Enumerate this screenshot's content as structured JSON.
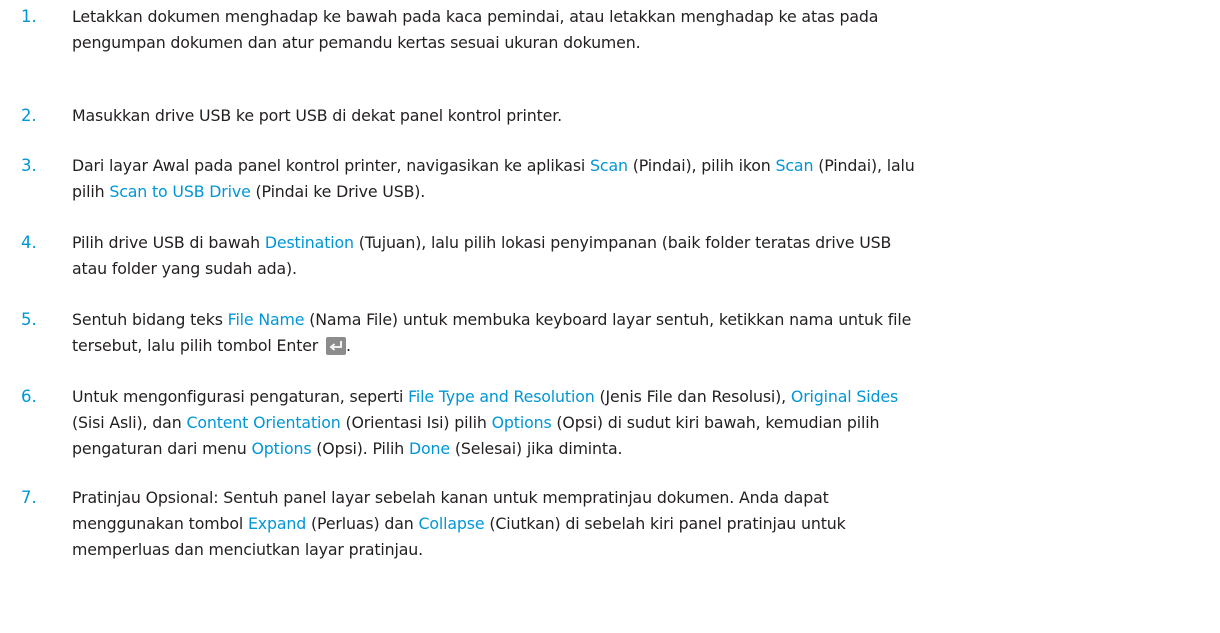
{
  "steps": [
    {
      "number": "1.",
      "lines": [
        [
          {
            "t": "Letakkan dokumen menghadap ke bawah pada kaca pemindai, atau letakkan menghadap ke atas pada"
          }
        ],
        [
          {
            "t": "pengumpan dokumen dan atur pemandu kertas sesuai ukuran dokumen."
          }
        ]
      ]
    },
    {
      "number": "2.",
      "lines": [
        [
          {
            "t": "Masukkan drive USB ke port USB di dekat panel kontrol printer."
          }
        ]
      ]
    },
    {
      "number": "3.",
      "lines": [
        [
          {
            "t": "Dari layar Awal pada panel kontrol printer, navigasikan ke aplikasi "
          },
          {
            "t": "Scan",
            "link": true
          },
          {
            "t": " (Pindai), pilih ikon "
          },
          {
            "t": "Scan",
            "link": true
          },
          {
            "t": " (Pindai), lalu"
          }
        ],
        [
          {
            "t": "pilih "
          },
          {
            "t": "Scan to USB Drive",
            "link": true
          },
          {
            "t": " (Pindai ke Drive USB)."
          }
        ]
      ]
    },
    {
      "number": "4.",
      "lines": [
        [
          {
            "t": "Pilih drive USB di bawah "
          },
          {
            "t": "Destination",
            "link": true
          },
          {
            "t": " (Tujuan), lalu pilih lokasi penyimpanan (baik folder teratas drive USB"
          }
        ],
        [
          {
            "t": "atau folder yang sudah ada)."
          }
        ]
      ]
    },
    {
      "number": "5.",
      "lines": [
        [
          {
            "t": "Sentuh bidang teks "
          },
          {
            "t": "File Name",
            "link": true
          },
          {
            "t": " (Nama File) untuk membuka keyboard layar sentuh, ketikkan nama untuk file"
          }
        ],
        [
          {
            "t": "tersebut, lalu pilih tombol Enter "
          },
          {
            "icon": "enter-icon"
          },
          {
            "t": "."
          }
        ]
      ]
    },
    {
      "number": "6.",
      "lines": [
        [
          {
            "t": "Untuk mengonfigurasi pengaturan, seperti "
          },
          {
            "t": "File Type and Resolution",
            "link": true
          },
          {
            "t": " (Jenis File dan Resolusi), "
          },
          {
            "t": "Original Sides",
            "link": true
          }
        ],
        [
          {
            "t": "(Sisi Asli), dan "
          },
          {
            "t": "Content Orientation",
            "link": true
          },
          {
            "t": " (Orientasi Isi) pilih "
          },
          {
            "t": "Options",
            "link": true
          },
          {
            "t": " (Opsi) di sudut kiri bawah, kemudian pilih"
          }
        ],
        [
          {
            "t": "pengaturan dari menu "
          },
          {
            "t": "Options",
            "link": true
          },
          {
            "t": " (Opsi). Pilih "
          },
          {
            "t": "Done",
            "link": true
          },
          {
            "t": " (Selesai) jika diminta."
          }
        ]
      ]
    },
    {
      "number": "7.",
      "lines": [
        [
          {
            "t": "Pratinjau Opsional: Sentuh panel layar sebelah kanan untuk mempratinjau dokumen. Anda dapat"
          }
        ],
        [
          {
            "t": "menggunakan tombol "
          },
          {
            "t": "Expand",
            "link": true
          },
          {
            "t": " (Perluas) dan "
          },
          {
            "t": "Collapse",
            "link": true
          },
          {
            "t": " (Ciutkan) di sebelah kiri panel pratinjau untuk"
          }
        ],
        [
          {
            "t": "memperluas dan menciutkan layar pratinjau."
          }
        ]
      ]
    }
  ],
  "colors": {
    "accent": "#0096d6",
    "text": "#231f20",
    "icon_bg": "#8c8c8c"
  }
}
